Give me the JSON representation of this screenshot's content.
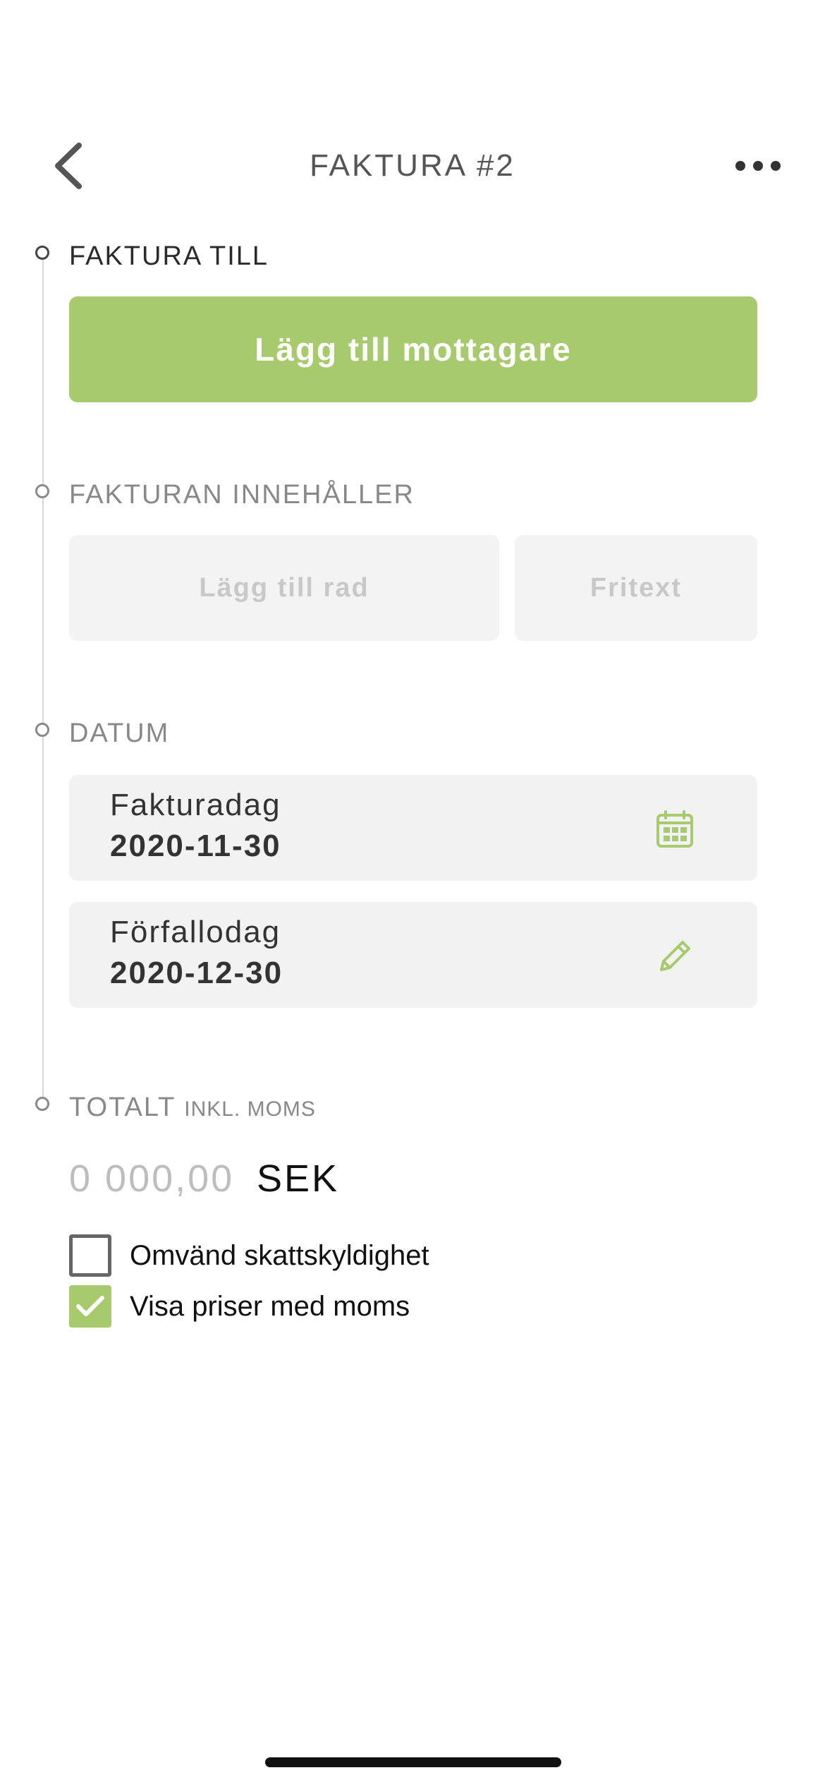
{
  "header": {
    "title": "FAKTURA #2",
    "back_icon": "chevron-left-icon",
    "more_icon": "more-horizontal-icon"
  },
  "sections": {
    "recipient": {
      "heading": "FAKTURA TILL",
      "add_recipient_label": "Lägg till mottagare"
    },
    "content": {
      "heading": "FAKTURAN INNEHÅLLER",
      "add_row_label": "Lägg till rad",
      "free_text_label": "Fritext"
    },
    "dates": {
      "heading": "DATUM",
      "invoice_date": {
        "label": "Fakturadag",
        "value": "2020-11-30",
        "icon": "calendar-icon"
      },
      "due_date": {
        "label": "Förfallodag",
        "value": "2020-12-30",
        "icon": "pencil-icon"
      }
    },
    "total": {
      "heading": "TOTALT",
      "heading_suffix": "INKL. MOMS",
      "amount": "0 000,00",
      "currency": "SEK"
    }
  },
  "options": {
    "reverse_charge": {
      "label": "Omvänd skattskyldighet",
      "checked": false
    },
    "show_prices_with_vat": {
      "label": "Visa priser med moms",
      "checked": true
    }
  },
  "colors": {
    "accent": "#a6ca6c",
    "muted_text": "#888888",
    "field_background": "#f2f2f2"
  }
}
